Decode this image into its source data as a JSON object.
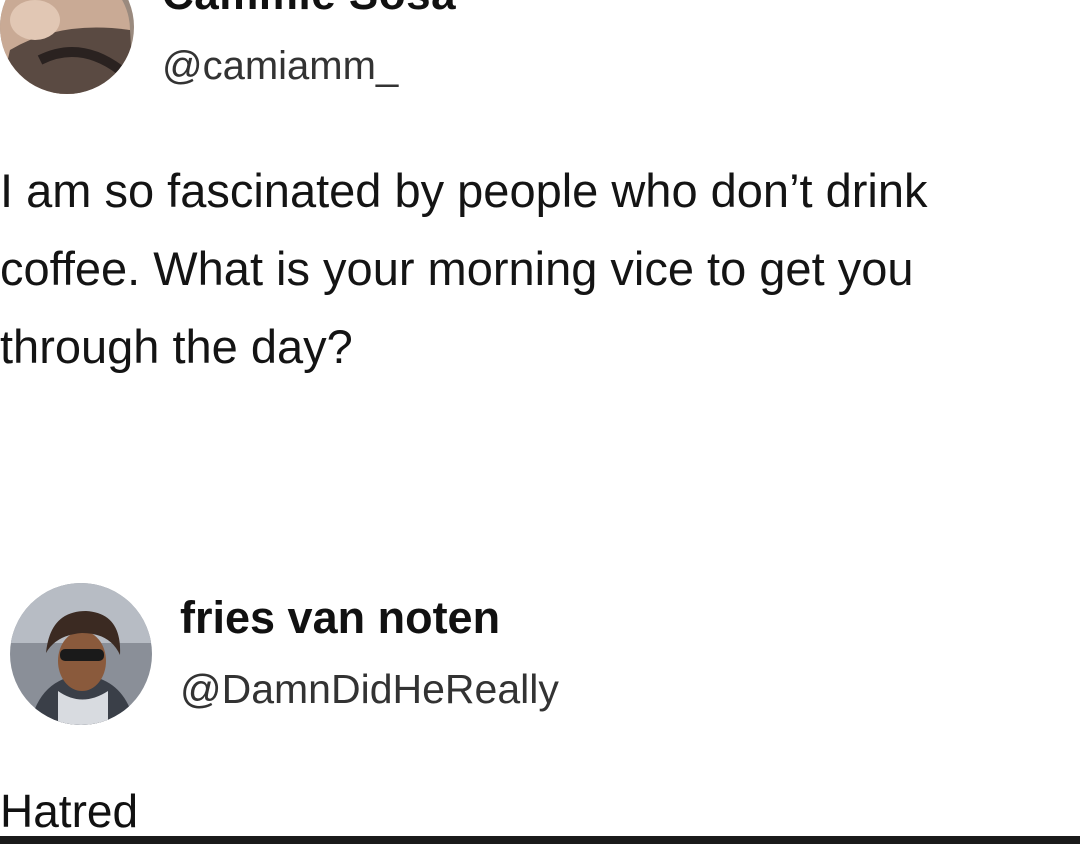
{
  "tweet": {
    "author_name": "Cammie Sosa",
    "author_handle": "@camiamm_",
    "text": "I am so fascinated by people who don’t drink coffee. What is your morning vice to get you through the day?"
  },
  "reply": {
    "author_name": "fries van noten",
    "author_handle": "@DamnDidHeReally",
    "text": "Hatred"
  },
  "icons": {
    "tweet_avatar": "profile-photo-icon",
    "reply_avatar": "profile-photo-icon"
  }
}
